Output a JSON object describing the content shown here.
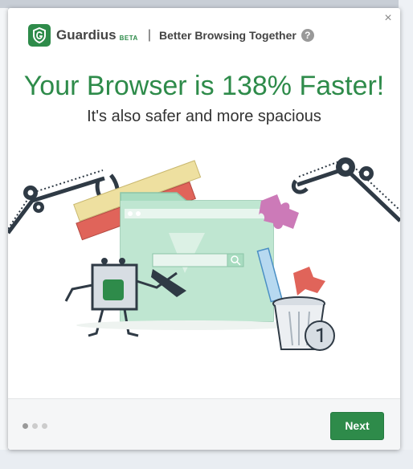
{
  "header": {
    "brand": "Guardius",
    "beta": "BETA",
    "separator": "|",
    "tagline": "Better Browsing Together",
    "help_glyph": "?"
  },
  "close_glyph": "×",
  "headline": "Your Browser is 138% Faster!",
  "subline": "It's also safer and more spacious",
  "footer": {
    "next_label": "Next",
    "pagination": {
      "total": 3,
      "current": 1
    }
  },
  "colors": {
    "brand_green": "#2e8b4a",
    "window_green": "#a8dcc0",
    "puzzle_pink": "#cc7ab8",
    "toolbar_red": "#e0645a",
    "ruler_yellow": "#eee0a0"
  },
  "icons": [
    "guardius-logo-icon",
    "help-icon",
    "close-icon",
    "gear-icon",
    "search-icon",
    "puzzle-icon"
  ]
}
